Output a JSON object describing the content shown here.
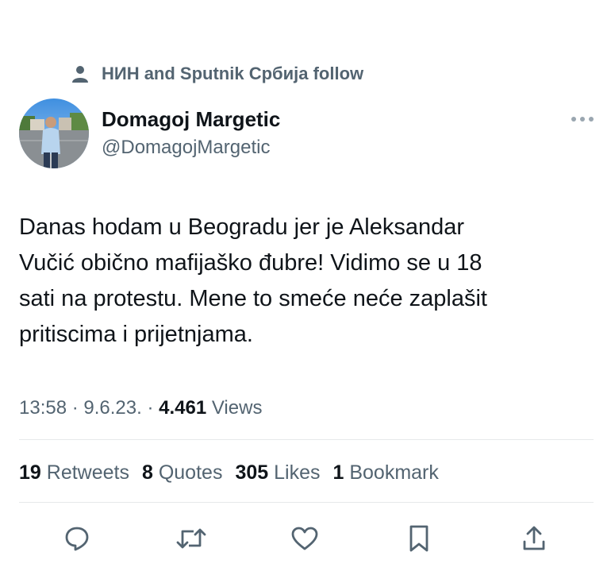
{
  "social_context": {
    "icon": "person-icon",
    "text": "НИН and Sputnik Србија follow"
  },
  "author": {
    "display_name": "Domagoj Margetic",
    "handle": "@DomagojMargetic",
    "avatar_icon": "avatar-photo"
  },
  "more_icon": "more-icon",
  "tweet": {
    "lines": [
      "Danas hodam u Beogradu jer je Aleksandar",
      "Vučić obično mafijaško đubre! Vidimo se u 18",
      "sati na protestu. Mene to smeće neće zaplašit",
      "pritiscima i prijetnjama."
    ]
  },
  "meta": {
    "time": "13:58",
    "sep1": " · ",
    "date": "9.6.23.",
    "sep2": " · ",
    "views_count": "4.461",
    "views_label": " Views"
  },
  "stats": {
    "retweets_count": "19",
    "retweets_label": " Retweets",
    "quotes_count": "8",
    "quotes_label": " Quotes",
    "likes_count": "305",
    "likes_label": " Likes",
    "bookmarks_count": "1",
    "bookmarks_label": " Bookmark"
  },
  "actions": [
    "reply-icon",
    "retweet-icon",
    "like-icon",
    "bookmark-icon",
    "share-icon"
  ],
  "colors": {
    "text_primary": "#0f1419",
    "text_secondary": "#536471",
    "icon": "#536471",
    "divider": "#e6e9ea"
  }
}
